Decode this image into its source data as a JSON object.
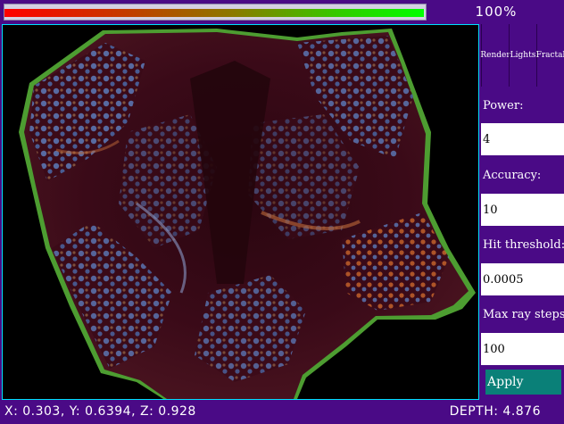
{
  "progress": {
    "label": "100%",
    "value": 1.0
  },
  "tabs": [
    {
      "label": "Render"
    },
    {
      "label": "Lights"
    },
    {
      "label": "Fractal"
    }
  ],
  "settings": {
    "power_label": "Power:",
    "power_value": "4",
    "accuracy_label": "Accuracy:",
    "accuracy_value": "10",
    "hit_threshold_label": "Hit threshold:",
    "hit_threshold_value": "0.0005",
    "max_ray_steps_label": "Max ray steps:",
    "max_ray_steps_value": "100",
    "apply_label": "Apply"
  },
  "status": {
    "coords": "X: 0.303, Y: 0.6394, Z: 0.928",
    "depth": "DEPTH: 4.876"
  },
  "colors": {
    "frame": "#4a0a86",
    "viewport_border": "#00e0ff",
    "apply_button": "#0a8078",
    "fractal_dark": "#3a0a14",
    "fractal_blue": "#4a6aa8",
    "fractal_orange": "#b8582a",
    "fractal_edge": "#6ac83a"
  }
}
